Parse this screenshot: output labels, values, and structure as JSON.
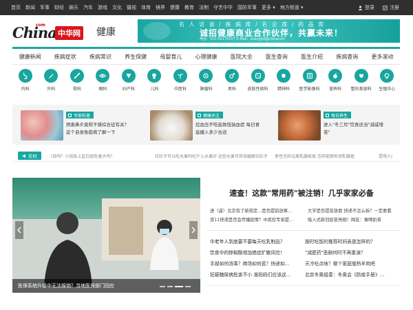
{
  "topnav": [
    "首页",
    "新闻",
    "军事",
    "财经",
    "娱乐",
    "汽车",
    "游戏",
    "文化",
    "摄视",
    "体育",
    "镜界",
    "健康",
    "教育",
    "法制",
    "守艺中华",
    "国防军事",
    "更多 ▾",
    "地方频道 ▾"
  ],
  "topright": {
    "login": "登录",
    "register": "注册"
  },
  "logo": {
    "china": "China",
    "com": "com",
    "badge": "中华网",
    "section": "健康"
  },
  "banner": {
    "top": "名 人 访 谈  /  疾 病 库  /  名 企 库  /  药 品 库",
    "main": "诚招健康商业合作伙伴，共赢未来！",
    "sub": "电话：010-56176107   E-Mail：zhangfei@chinacom"
  },
  "mainnav": [
    "健康新闻",
    "疾病症状",
    "疾病常识",
    "养生保健",
    "母婴育儿",
    "心理健康",
    "医院大全",
    "医生查询",
    "医生介绍",
    "疾病查询",
    "更多滚动"
  ],
  "depts": [
    {
      "label": "内科",
      "icon": "stomach-icon"
    },
    {
      "label": "外科",
      "icon": "scalpel-icon"
    },
    {
      "label": "骨科",
      "icon": "bone-icon"
    },
    {
      "label": "眼科",
      "icon": "eye-icon"
    },
    {
      "label": "妇产科",
      "icon": "uterus-icon"
    },
    {
      "label": "儿科",
      "icon": "baby-icon"
    },
    {
      "label": "中医科",
      "icon": "herb-icon"
    },
    {
      "label": "肿瘤科",
      "icon": "cell-icon"
    },
    {
      "label": "男科",
      "icon": "male-icon"
    },
    {
      "label": "皮肤性病科",
      "icon": "skin-icon"
    },
    {
      "label": "精神科",
      "icon": "brain-icon"
    },
    {
      "label": "医学影像科",
      "icon": "xray-icon"
    },
    {
      "label": "营养科",
      "icon": "nutrition-icon"
    },
    {
      "label": "整形美容科",
      "icon": "beauty-icon"
    },
    {
      "label": "生殖中心",
      "icon": "reproduction-icon"
    }
  ],
  "cards": [
    {
      "tag": "专家科普",
      "line1": "频患鼻炎竟和干燥综合征有关？",
      "line2": "这个自身免疫病了解一下"
    },
    {
      "tag": "健康关注",
      "line1": "控血压不吃盐致低钠血症 每日食",
      "line2": "盐摄入多少合适"
    },
    {
      "tag": "每日养生",
      "line1": "进入\"冬三月\"饮食适当\"减咸增",
      "line2": "苦\""
    }
  ],
  "ticker": {
    "label": "实时",
    "items": [
      "(效吗？小孩脸上起白斑危害大吗？",
      "拉肚子可以吃水果吗吃什么水果好 这些水果可有效缓解拉肚子",
      "男性怎样远离乳腺疾病 怎样能够检测乳腺癌",
      "昆明人|"
    ]
  },
  "hero": {
    "caption": "医保系统升级中无法报销？当地医保部门回应"
  },
  "headline": "速查！这款\"常用药\"被注销！几乎家家必备",
  "sublist": [
    [
      "进（返）北京有了新规定...是否提前放寒...",
      "大学是否提前放假 快递不怎么拆？一定要看"
    ],
    [
      "双11快递是否会传播疫情？中疾控专家提...",
      "吸入式新冠疫苗亮相！网友：像喝奶茶"
    ]
  ],
  "news": [
    [
      "中老年人到底要不要每天吃乳制品？",
      "按时吃饭的推荐时间表是怎样的？"
    ],
    [
      "饮食中的棕榈酸增加癌症扩散风险！",
      "\"减肥药\"悲剧何时不再重演？"
    ],
    [
      "手部如何消毒？商场如何逛？快递如...",
      "天冷吃点啥？做个家庭版热羊肉吧"
    ],
    [
      "妊娠糖尿病危害不小 准妈妈们应该这...",
      "北京冬奥组委：冬奥会《防疫手册》..."
    ]
  ]
}
